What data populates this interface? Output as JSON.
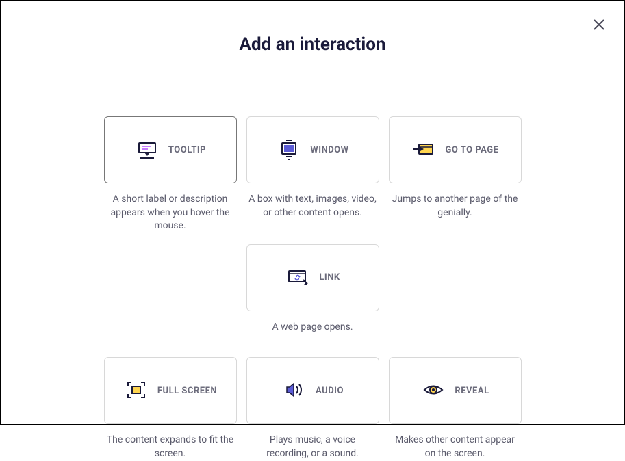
{
  "title": "Add an interaction",
  "options": [
    {
      "label": "TOOLTIP",
      "desc": "A short label or description appears when you hover the mouse."
    },
    {
      "label": "WINDOW",
      "desc": "A box with text, images, video, or other content opens."
    },
    {
      "label": "GO TO PAGE",
      "desc": "Jumps to another page of the genially."
    },
    {
      "label": "LINK",
      "desc": "A web page opens."
    },
    {
      "label": "FULL SCREEN",
      "desc": "The content expands to fit the screen."
    },
    {
      "label": "AUDIO",
      "desc": "Plays music, a voice recording, or a sound."
    },
    {
      "label": "REVEAL",
      "desc": "Makes other content appear on the screen."
    }
  ]
}
